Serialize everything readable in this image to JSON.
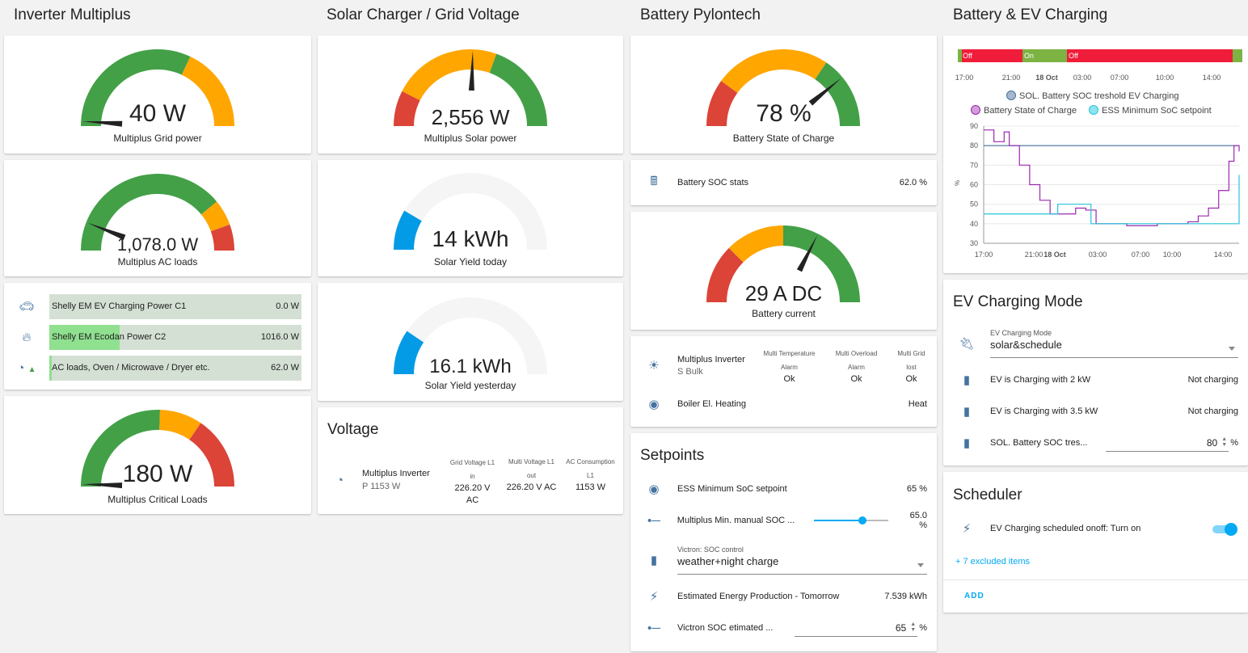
{
  "columns": {
    "c1": "Inverter Multiplus",
    "c2": "Solar Charger / Grid Voltage",
    "c3": "Battery Pylontech",
    "c4": "Battery & EV Charging"
  },
  "gauges": {
    "grid": {
      "value": "40 W",
      "label": "Multiplus Grid power",
      "level": 0.02
    },
    "ac": {
      "value": "1,078.0 W",
      "label": "Multiplus AC loads",
      "level": 0.12
    },
    "critical": {
      "value": "180 W",
      "label": "Multiplus Critical Loads",
      "level": 0.01
    },
    "solar": {
      "value": "2,556 W",
      "label": "Multiplus Solar power",
      "level": 0.51
    },
    "yield_today": {
      "value": "14 kWh",
      "label": "Solar Yield today",
      "level": 0.17
    },
    "yield_yesterday": {
      "value": "16.1 kWh",
      "label": "Solar Yield yesterday",
      "level": 0.19
    },
    "soc": {
      "value": "78 %",
      "label": "Battery State of Charge",
      "level": 0.78
    },
    "current": {
      "value": "29 A DC",
      "label": "Battery current",
      "level": 0.65
    }
  },
  "shelly": {
    "items": [
      {
        "label": "Shelly EM EV Charging Power C1",
        "value": "0.0 W",
        "fill": 0.0
      },
      {
        "label": "Shelly EM Ecodan Power C2",
        "value": "1016.0 W",
        "fill": 0.28
      },
      {
        "label": "AC loads, Oven / Microwave / Dryer etc.",
        "value": "62.0 W",
        "fill": 0.01
      }
    ]
  },
  "voltage": {
    "title": "Voltage",
    "name": "Multiplus Inverter",
    "sub": "P 1153 W",
    "cols": [
      {
        "h1": "Grid Voltage L1",
        "h2": "in",
        "v1": "226.20 V",
        "v2": "AC"
      },
      {
        "h1": "Multi Voltage L1",
        "h2": "out",
        "v1": "226.20 V AC",
        "v2": ""
      },
      {
        "h1": "AC Consumption",
        "h2": "L1",
        "v1": "1153 W",
        "v2": ""
      }
    ]
  },
  "battery_stats": {
    "label": "Battery SOC stats",
    "value": "62.0 %"
  },
  "inverter_status": {
    "name": "Multiplus Inverter",
    "sub": "S Bulk",
    "cols": [
      {
        "h1": "Multi Temperature",
        "h2": "Alarm",
        "v": "Ok"
      },
      {
        "h1": "Multi Overload",
        "h2": "Alarm",
        "v": "Ok"
      },
      {
        "h1": "Multi Grid",
        "h2": "lost",
        "v": "Ok"
      }
    ],
    "boiler_label": "Boiler El. Heating",
    "boiler_value": "Heat"
  },
  "setpoints": {
    "title": "Setpoints",
    "ess_label": "ESS Minimum SoC setpoint",
    "ess_value": "65 %",
    "slider_label": "Multiplus Min. manual SOC ...",
    "slider_value": "65.0 %",
    "slider_level": 0.65,
    "select_label": "Victron: SOC control",
    "select_value": "weather+night charge",
    "energy_label": "Estimated Energy Production - Tomorrow",
    "energy_value": "7.539 kWh",
    "soc_est_label": "Victron SOC etimated ...",
    "soc_est_value": "65",
    "soc_est_unit": "%"
  },
  "chart_data": {
    "type": "line",
    "timeline_labels": [
      "Off",
      "On",
      "Off"
    ],
    "x_ticks": [
      "17:00",
      "21:00",
      "18 Oct",
      "03:00",
      "07:00",
      "10:00",
      "14:00"
    ],
    "legend": [
      "SOL. Battery SOC treshold EV Charging",
      "Battery State of Charge",
      "ESS Minimum SoC setpoint"
    ],
    "ylabel": "%",
    "ylim": [
      30,
      90
    ],
    "y_ticks": [
      "90",
      "80",
      "70",
      "60",
      "50",
      "40",
      "30"
    ],
    "colors": {
      "threshold": "#44739e",
      "soc": "#9c27b0",
      "ess": "#26c6da",
      "on": "#7cb342",
      "off": "#ef1d3a"
    },
    "series": [
      {
        "name": "SOL. Battery SOC treshold EV Charging",
        "x": [
          0,
          100
        ],
        "values": [
          80,
          80
        ]
      },
      {
        "name": "Battery State of Charge",
        "x": [
          0,
          4,
          8,
          10,
          14,
          18,
          22,
          26,
          30,
          32,
          36,
          40,
          44,
          48,
          52,
          56,
          60,
          64,
          68,
          72,
          76,
          80,
          84,
          88,
          92,
          96,
          98,
          100
        ],
        "values": [
          88,
          82,
          87,
          80,
          70,
          60,
          52,
          45,
          45,
          45,
          48,
          47,
          40,
          40,
          40,
          39,
          39,
          39,
          40,
          40,
          40,
          41,
          44,
          48,
          57,
          72,
          80,
          77
        ]
      },
      {
        "name": "ESS Minimum SoC setpoint",
        "x": [
          0,
          28,
          29,
          40,
          42,
          99,
          100
        ],
        "values": [
          45,
          45,
          50,
          50,
          40,
          40,
          65
        ]
      }
    ]
  },
  "ev_mode": {
    "title": "EV Charging Mode",
    "select_label": "EV Charging Mode",
    "select_value": "solar&schedule",
    "rows": [
      {
        "label": "EV is Charging with 2 kW",
        "value": "Not charging"
      },
      {
        "label": "EV is Charging with 3.5 kW",
        "value": "Not charging"
      }
    ],
    "threshold_label": "SOL. Battery SOC tres...",
    "threshold_value": "80",
    "threshold_unit": "%"
  },
  "scheduler": {
    "title": "Scheduler",
    "item": "EV Charging scheduled onoff: Turn on",
    "excluded": "+ 7 excluded items",
    "add": "ADD"
  }
}
